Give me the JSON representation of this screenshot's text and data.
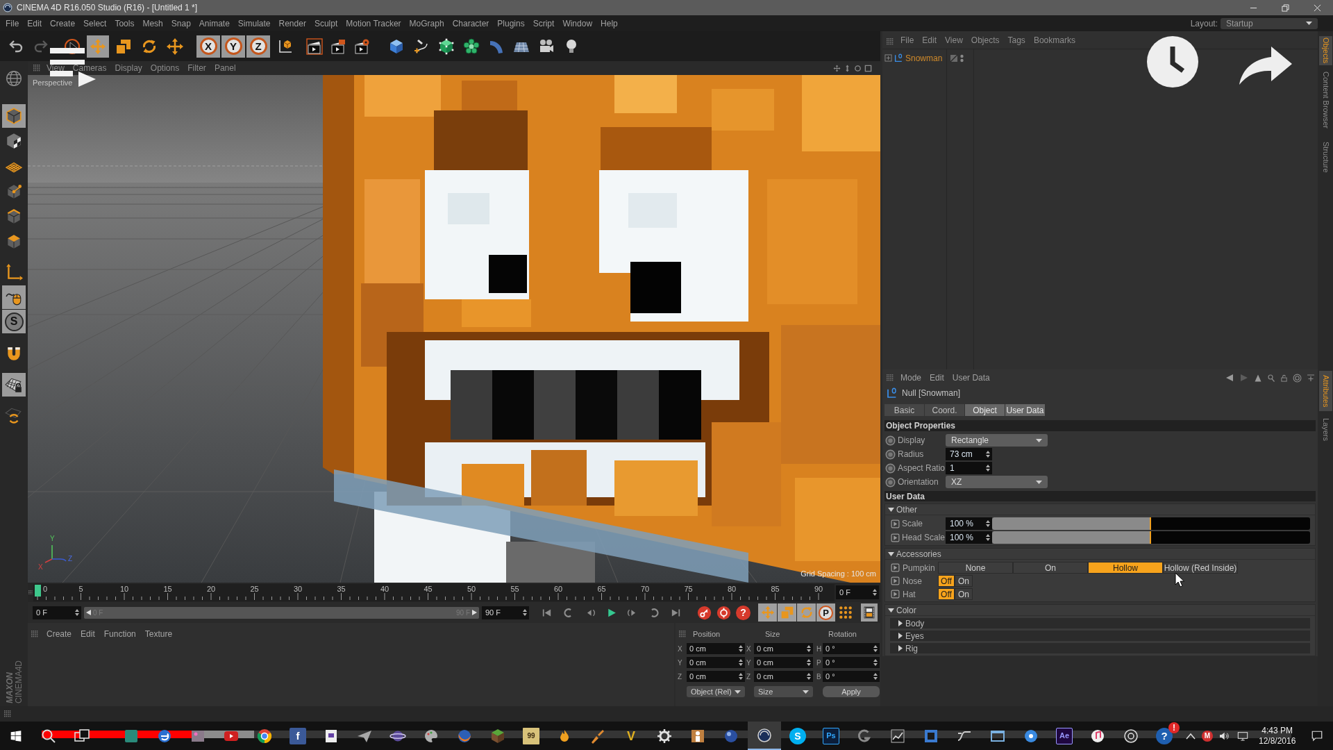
{
  "window": {
    "title": "CINEMA 4D R16.050 Studio (R16) - [Untitled 1 *]"
  },
  "menu_bar": {
    "items": [
      "File",
      "Edit",
      "Create",
      "Select",
      "Tools",
      "Mesh",
      "Snap",
      "Animate",
      "Simulate",
      "Render",
      "Sculpt",
      "Motion Tracker",
      "MoGraph",
      "Character",
      "Plugins",
      "Script",
      "Window",
      "Help"
    ],
    "layout_label": "Layout:",
    "layout_value": "Startup"
  },
  "toolbar": {
    "groups": [
      {
        "tools": [
          {
            "selected": false,
            "disabled": false
          },
          {
            "selected": false,
            "disabled": true
          }
        ]
      },
      {
        "tools": [
          {
            "selected": false,
            "disabled": false
          },
          {
            "selected": true,
            "disabled": false
          },
          {
            "selected": false,
            "disabled": false
          },
          {
            "selected": false,
            "disabled": false
          },
          {
            "selected": false,
            "disabled": false
          }
        ]
      },
      {
        "tools": [
          {
            "label": "X",
            "selected": true,
            "disabled": false
          },
          {
            "label": "Y",
            "selected": true,
            "disabled": false
          },
          {
            "label": "Z",
            "selected": true,
            "disabled": false
          }
        ]
      },
      {
        "tools": [
          {
            "selected": false,
            "disabled": false
          }
        ]
      },
      {
        "tools": [
          {
            "selected": false,
            "disabled": false
          },
          {
            "selected": false,
            "disabled": false
          },
          {
            "selected": false,
            "disabled": false
          }
        ]
      },
      {
        "tools": [
          {
            "selected": false,
            "disabled": false
          },
          {
            "selected": false,
            "disabled": false
          },
          {
            "selected": false,
            "disabled": false
          },
          {
            "selected": false,
            "disabled": false
          },
          {
            "selected": false,
            "disabled": false
          },
          {
            "selected": false,
            "disabled": false
          },
          {
            "selected": false,
            "disabled": false
          },
          {
            "selected": false,
            "disabled": false
          }
        ]
      }
    ]
  },
  "left_tools": {
    "groups": [
      {
        "tools": [
          {
            "selected": false
          }
        ]
      },
      {
        "tools": [
          {
            "selected": true
          },
          {
            "selected": false
          },
          {
            "selected": false
          },
          {
            "selected": false
          },
          {
            "selected": false
          },
          {
            "selected": false
          }
        ]
      },
      {
        "tools": [
          {
            "selected": false
          },
          {
            "selected": true
          },
          {
            "label": "S",
            "selected": true
          }
        ]
      },
      {
        "tools": [
          {
            "selected": false
          },
          {
            "selected": true
          },
          {
            "selected": false
          }
        ]
      }
    ]
  },
  "viewport": {
    "menu": [
      "View",
      "Cameras",
      "Display",
      "Options",
      "Filter",
      "Panel"
    ],
    "camera": "Perspective",
    "axis_labels": [
      "Y",
      "X",
      "Z"
    ],
    "grid_spacing": "Grid Spacing : 100 cm"
  },
  "timeline": {
    "ticks": [
      "0",
      "5",
      "10",
      "15",
      "20",
      "25",
      "30",
      "35",
      "40",
      "45",
      "50",
      "55",
      "60",
      "65",
      "70",
      "75",
      "80",
      "85",
      "90"
    ],
    "playhead": {
      "level": 0
    },
    "current_frame": "0 F",
    "start_frame": "0 F",
    "range_start": "0 F",
    "range_end": "90 F",
    "end_frame": "90 F",
    "record_label": "?",
    "key_buttons": [
      {
        "selected": true
      },
      {
        "selected": true
      },
      {
        "selected": true
      },
      {
        "label": "P",
        "selected": true
      },
      {
        "selected": false
      },
      {
        "selected": true
      }
    ]
  },
  "material_manager": {
    "menu": [
      "Create",
      "Edit",
      "Function",
      "Texture"
    ]
  },
  "coordinates": {
    "headers": [
      "Position",
      "Size",
      "Rotation"
    ],
    "rows": [
      {
        "cells": [
          {
            "axis": "X",
            "value": "0 cm"
          },
          {
            "axis": "X",
            "value": "0 cm"
          },
          {
            "axis": "H",
            "value": "0 °"
          }
        ]
      },
      {
        "cells": [
          {
            "axis": "Y",
            "value": "0 cm"
          },
          {
            "axis": "Y",
            "value": "0 cm"
          },
          {
            "axis": "P",
            "value": "0 °"
          }
        ]
      },
      {
        "cells": [
          {
            "axis": "Z",
            "value": "0 cm"
          },
          {
            "axis": "Z",
            "value": "0 cm"
          },
          {
            "axis": "B",
            "value": "0 °"
          }
        ]
      }
    ],
    "dropdowns": [
      "Object (Rel)",
      "Size"
    ],
    "apply": "Apply"
  },
  "logo": {
    "brand": "MAXON",
    "product": "CINEMA4D"
  },
  "object_manager": {
    "menu": [
      "File",
      "Edit",
      "View",
      "Objects",
      "Tags",
      "Bookmarks"
    ],
    "objects": [
      {
        "name": "Snowman",
        "expanded": false
      }
    ]
  },
  "attributes": {
    "menu": [
      "Mode",
      "Edit",
      "User Data"
    ],
    "title": "Null [Snowman]",
    "tabs": [
      {
        "label": "Basic",
        "selected": false
      },
      {
        "label": "Coord.",
        "selected": false
      },
      {
        "label": "Object",
        "selected": true
      },
      {
        "label": "User Data",
        "selected": true
      }
    ],
    "object_properties": {
      "title": "Object Properties",
      "fields": [
        {
          "kind": "dropdown",
          "label": "Display",
          "value": "Rectangle"
        },
        {
          "kind": "number",
          "label": "Radius",
          "value": "73 cm"
        },
        {
          "kind": "number",
          "label": "Aspect Ratio",
          "value": "1"
        },
        {
          "kind": "dropdown",
          "label": "Orientation",
          "value": "XZ"
        }
      ]
    },
    "user_data": {
      "title": "User Data",
      "groups": [
        {
          "title": "Other",
          "expanded": true,
          "fields": [
            {
              "kind": "slider",
              "label": "Scale",
              "value": "100 %",
              "level": 0.5
            },
            {
              "kind": "slider",
              "label": "Head Scale",
              "value": "100 %",
              "level": 0.5
            }
          ]
        },
        {
          "title": "Accessories",
          "expanded": true,
          "fields": [
            {
              "kind": "choice",
              "label": "Pumpkin",
              "options": [
                {
                  "label": "None",
                  "selected": false
                },
                {
                  "label": "On",
                  "selected": false
                },
                {
                  "label": "Hollow",
                  "selected": true
                },
                {
                  "label": "Hollow (Red Inside)",
                  "selected": false
                }
              ]
            },
            {
              "kind": "choice",
              "label": "Nose",
              "options": [
                {
                  "label": "Off",
                  "selected": true
                },
                {
                  "label": "On",
                  "selected": false
                }
              ]
            },
            {
              "kind": "choice",
              "label": "Hat",
              "options": [
                {
                  "label": "Off",
                  "selected": true
                },
                {
                  "label": "On",
                  "selected": false
                }
              ]
            }
          ]
        },
        {
          "title": "Color",
          "expanded": true,
          "subgroups": [
            {
              "title": "Body",
              "expanded": false
            },
            {
              "title": "Eyes",
              "expanded": false
            },
            {
              "title": "Rig",
              "expanded": false
            }
          ]
        }
      ]
    }
  },
  "side_tabs": {
    "top": [
      {
        "label": "Objects",
        "selected": true
      },
      {
        "label": "Content Browser",
        "selected": false
      },
      {
        "label": "Structure",
        "selected": false
      }
    ],
    "bottom": [
      {
        "label": "Attributes",
        "selected": true
      },
      {
        "label": "Layers",
        "selected": false
      }
    ]
  },
  "taskbar": {
    "items": [
      {
        "active": false
      },
      {
        "active": false
      },
      {
        "active": false
      },
      {
        "active": false
      },
      {
        "active": false
      },
      {
        "active": false
      },
      {
        "active": false
      },
      {
        "label": "f",
        "active": false
      },
      {
        "active": false
      },
      {
        "active": false
      },
      {
        "active": false
      },
      {
        "active": false
      },
      {
        "active": false
      },
      {
        "active": false
      },
      {
        "label": "99",
        "active": false
      },
      {
        "active": false
      },
      {
        "active": false
      },
      {
        "label": "V",
        "active": false
      },
      {
        "active": false
      },
      {
        "active": false
      },
      {
        "active": false
      },
      {
        "active": true
      },
      {
        "label": "S",
        "active": false
      },
      {
        "label": "Ps",
        "active": false
      },
      {
        "active": false
      },
      {
        "active": false
      },
      {
        "active": false
      },
      {
        "active": false
      },
      {
        "active": false
      },
      {
        "active": false
      },
      {
        "label": "Ae",
        "active": false
      },
      {
        "active": false
      },
      {
        "active": false
      },
      {
        "label": "?",
        "badge": "!",
        "active": false
      }
    ],
    "tray_badge": "M",
    "time": "4:43 PM",
    "date": "12/8/2016"
  },
  "video_player": {
    "progress": {
      "level": 0.12
    },
    "buffer": {
      "level": 0.17
    }
  }
}
